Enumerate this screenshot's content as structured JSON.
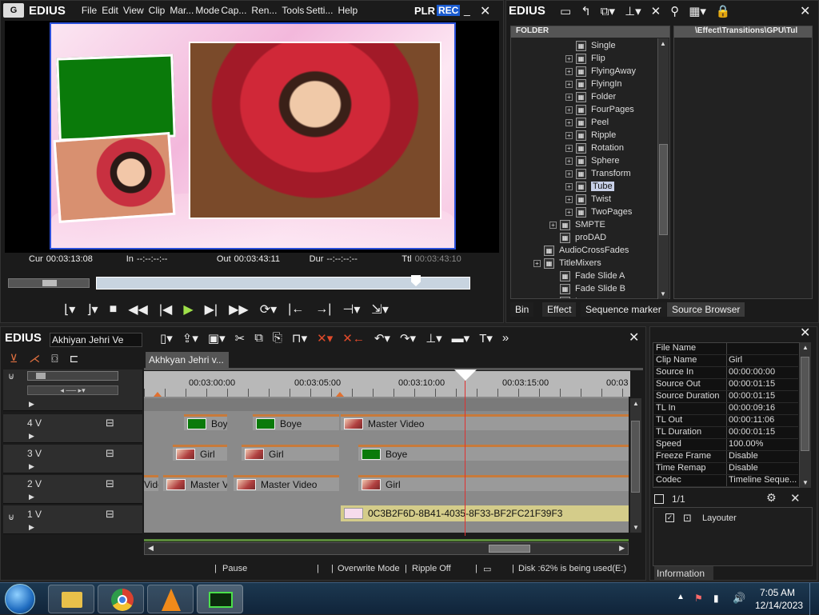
{
  "player": {
    "logo": "EDIUS",
    "menu": [
      "File",
      "Edit",
      "View",
      "Clip",
      "Mar...",
      "Mode",
      "Cap...",
      "Ren...",
      "Tools",
      "Setti...",
      "Help"
    ],
    "plr": "PLR",
    "rec": "REC",
    "cur_label": "Cur",
    "cur": "00:03:13:08",
    "in_label": "In",
    "in": "--:--:--:--",
    "out_label": "Out",
    "out": "00:03:43:11",
    "dur_label": "Dur",
    "dur": "--:--:--:--",
    "ttl_label": "Ttl",
    "ttl": "00:03:43:10"
  },
  "bin": {
    "logo": "EDIUS",
    "folder_header": "FOLDER",
    "path": "\\Effect\\Transitions\\GPU\\Tul",
    "tree": [
      {
        "label": "Single",
        "indent": 3,
        "plus": false
      },
      {
        "label": "Flip",
        "indent": 3,
        "plus": true
      },
      {
        "label": "FlyingAway",
        "indent": 3,
        "plus": true
      },
      {
        "label": "FlyingIn",
        "indent": 3,
        "plus": true
      },
      {
        "label": "Folder",
        "indent": 3,
        "plus": true
      },
      {
        "label": "FourPages",
        "indent": 3,
        "plus": true
      },
      {
        "label": "Peel",
        "indent": 3,
        "plus": true
      },
      {
        "label": "Ripple",
        "indent": 3,
        "plus": true
      },
      {
        "label": "Rotation",
        "indent": 3,
        "plus": true
      },
      {
        "label": "Sphere",
        "indent": 3,
        "plus": true
      },
      {
        "label": "Transform",
        "indent": 3,
        "plus": true
      },
      {
        "label": "Tube",
        "indent": 3,
        "plus": true,
        "selected": true
      },
      {
        "label": "Twist",
        "indent": 3,
        "plus": true
      },
      {
        "label": "TwoPages",
        "indent": 3,
        "plus": true
      },
      {
        "label": "SMPTE",
        "indent": 2,
        "plus": true
      },
      {
        "label": "proDAD",
        "indent": 2,
        "plus": false
      },
      {
        "label": "AudioCrossFades",
        "indent": 1,
        "plus": false
      },
      {
        "label": "TitleMixers",
        "indent": 1,
        "plus": true
      },
      {
        "label": "Fade Slide A",
        "indent": 2,
        "plus": false
      },
      {
        "label": "Fade Slide B",
        "indent": 2,
        "plus": false
      },
      {
        "label": "Laser",
        "indent": 2,
        "plus": false
      }
    ],
    "tabs": [
      "Bin",
      "Effect",
      "Sequence marker",
      "Source Browser"
    ]
  },
  "timeline": {
    "logo": "EDIUS",
    "project": "Akhiyan Jehri Ve",
    "seq_tab": "Akhkyan Jehri v...",
    "ruler": [
      "00:03:00:00",
      "00:03:05:00",
      "00:03:10:00",
      "00:03:15:00",
      "00:03"
    ],
    "tracks": [
      {
        "label": "4 V"
      },
      {
        "label": "3 V"
      },
      {
        "label": "2 V"
      },
      {
        "label": "1 V"
      }
    ],
    "clips4": [
      "Boy",
      "Boye",
      "Master Video"
    ],
    "clips3": [
      "Girl",
      "Girl",
      "Boye"
    ],
    "clips2": [
      "Vide",
      "Master V",
      "Master Video",
      "Girl"
    ],
    "clip1": "0C3B2F6D-8B41-4035-8F33-BF2FC21F39F3"
  },
  "status": {
    "pause": "Pause",
    "mode": "Overwrite Mode",
    "ripple": "Ripple Off",
    "disk": "Disk :62% is being used(E:)"
  },
  "info": {
    "rows": [
      [
        "File Name",
        ""
      ],
      [
        "Clip Name",
        "Girl"
      ],
      [
        "Source In",
        "00:00:00:00"
      ],
      [
        "Source Out",
        "00:00:01:15"
      ],
      [
        "Source Duration",
        "00:00:01:15"
      ],
      [
        "TL In",
        "00:00:09:16"
      ],
      [
        "TL Out",
        "00:00:11:06"
      ],
      [
        "TL Duration",
        "00:00:01:15"
      ],
      [
        "Speed",
        "100.00%"
      ],
      [
        "Freeze Frame",
        "Disable"
      ],
      [
        "Time Remap",
        "Disable"
      ],
      [
        "Codec",
        "Timeline Seque..."
      ]
    ],
    "page": "1/1",
    "layouter": "Layouter",
    "tab": "Information"
  },
  "taskbar": {
    "time": "7:05 AM",
    "date": "12/14/2023"
  }
}
